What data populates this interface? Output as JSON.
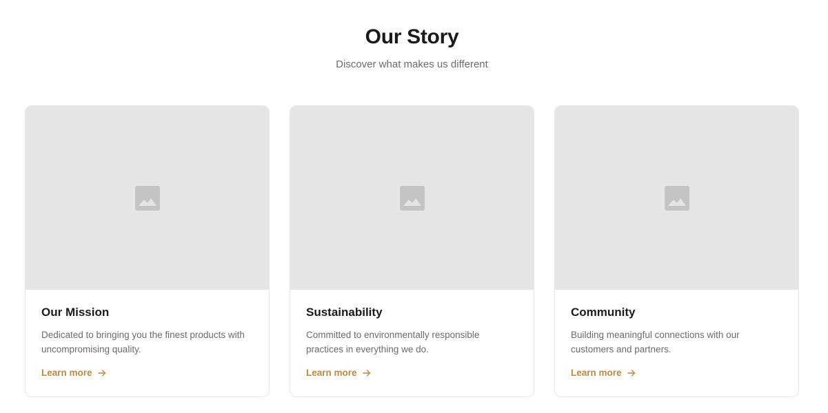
{
  "header": {
    "title": "Our Story",
    "subtitle": "Discover what makes us different"
  },
  "cards": [
    {
      "title": "Our Mission",
      "description": "Dedicated to bringing you the finest products with uncompromising quality.",
      "link_label": "Learn more",
      "image_icon": "image-placeholder-icon"
    },
    {
      "title": "Sustainability",
      "description": "Committed to environmentally responsible practices in everything we do.",
      "link_label": "Learn more",
      "image_icon": "image-placeholder-icon"
    },
    {
      "title": "Community",
      "description": "Building meaningful connections with our customers and partners.",
      "link_label": "Learn more",
      "image_icon": "image-placeholder-icon"
    }
  ],
  "colors": {
    "accent": "#b98a47",
    "title": "#1a1a1a",
    "muted": "#6b6b6b",
    "placeholder_bg": "#e5e5e5",
    "placeholder_icon": "#c4c4c4"
  }
}
